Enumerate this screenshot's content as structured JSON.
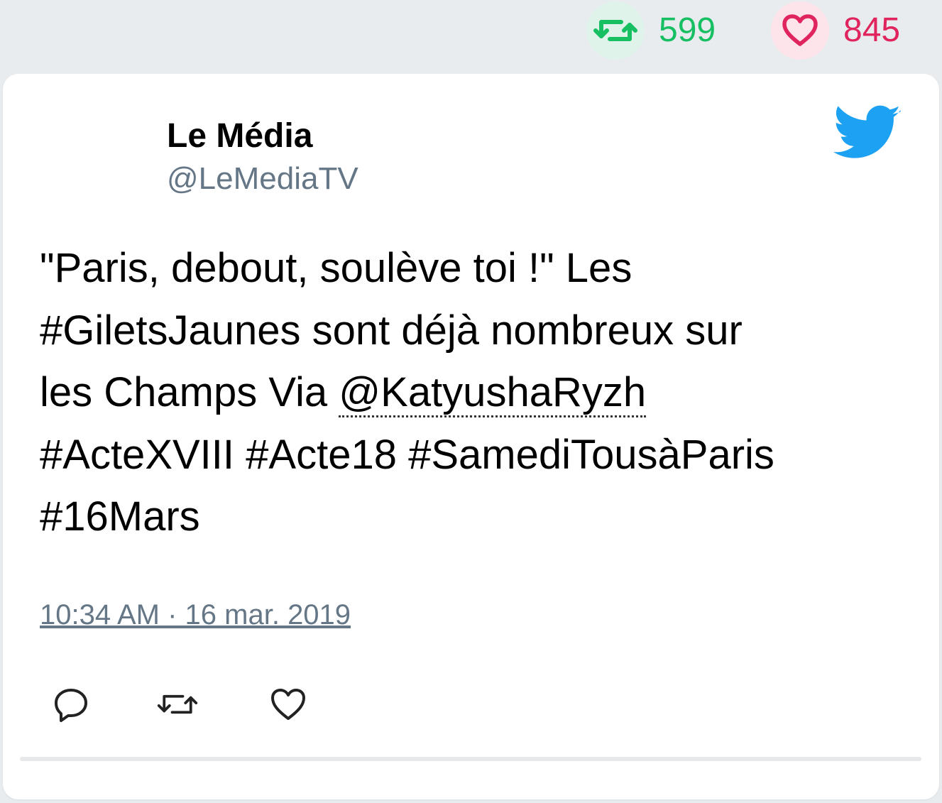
{
  "stats": {
    "retweets": "599",
    "likes": "845",
    "colors": {
      "retweet": "#17bf63",
      "like": "#e0245e"
    }
  },
  "author": {
    "name": "Le Média",
    "handle": "@LeMediaTV"
  },
  "tweet": {
    "text_line1": "\"Paris, debout, soulève toi !\" Les",
    "text_line2": "#GiletsJaunes sont déjà nombreux sur",
    "text_line3_prefix": "les Champs Via ",
    "mention": "@KatyushaRyzh",
    "text_line4": "#ActeXVIII #Acte18 #SamediTousàParis",
    "text_line5": "#16Mars",
    "timestamp": "10:34 AM · 16 mar. 2019"
  },
  "icons": {
    "brand": "twitter-bird-icon",
    "actions": [
      "reply-icon",
      "retweet-icon",
      "like-icon"
    ],
    "brand_color": "#1da1f2"
  }
}
